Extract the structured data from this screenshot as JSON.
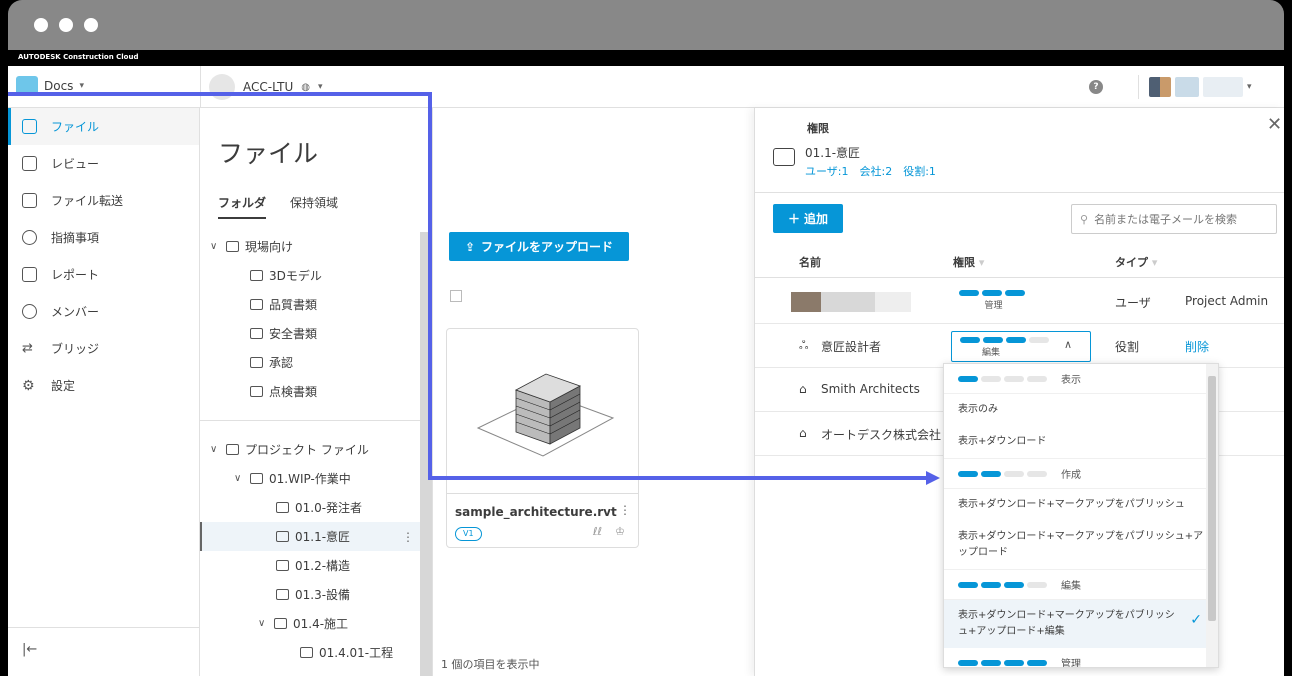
{
  "brand": "AUTODESK Construction Cloud",
  "topbar": {
    "module": "Docs",
    "project": "ACC-LTU",
    "help": "?"
  },
  "sidenav": {
    "items": [
      {
        "label": "ファイル",
        "icon": "file-icon",
        "active": true
      },
      {
        "label": "レビュー",
        "icon": "review-icon"
      },
      {
        "label": "ファイル転送",
        "icon": "transfer-icon"
      },
      {
        "label": "指摘事項",
        "icon": "issues-icon"
      },
      {
        "label": "レポート",
        "icon": "report-icon"
      },
      {
        "label": "メンバー",
        "icon": "members-icon"
      },
      {
        "label": "ブリッジ",
        "icon": "bridge-icon"
      },
      {
        "label": "設定",
        "icon": "settings-icon"
      }
    ],
    "collapse": "|←"
  },
  "files": {
    "title": "ファイル",
    "tabs": [
      "フォルダ",
      "保持領域"
    ],
    "tree_field": [
      "現場向け",
      "3Dモデル",
      "品質書類",
      "安全書類",
      "承認",
      "点検書類"
    ],
    "tree_project": [
      "プロジェクト ファイル",
      "01.WIP-作業中",
      "01.0-発注者",
      "01.1-意匠",
      "01.2-構造",
      "01.3-設備",
      "01.4-施工",
      "01.4.01-工程"
    ],
    "upload": "ファイルをアップロード",
    "card_name": "sample_architecture.rvt",
    "card_version": "V1",
    "count": "1 個の項目を表示中"
  },
  "permissions": {
    "title": "権限",
    "folder": "01.1-意匠",
    "counts": "ユーザ:1　会社:2　役割:1",
    "add": "追加",
    "search_placeholder": "名前または電子メールを検索",
    "col_name": "名前",
    "col_perm": "権限",
    "col_type": "タイプ",
    "row1": {
      "perm": "管理",
      "type": "ユーザ",
      "role": "Project Admin"
    },
    "row2": {
      "name": "意匠設計者",
      "perm": "編集",
      "type": "役割",
      "action": "削除"
    },
    "row3": {
      "name": "Smith Architects"
    },
    "row4": {
      "name": "オートデスク株式会社"
    }
  },
  "dropdown": {
    "g_view": "表示",
    "o_view_only": "表示のみ",
    "o_view_dl": "表示+ダウンロード",
    "g_create": "作成",
    "o_create1": "表示+ダウンロード+マークアップをパブリッシュ",
    "o_create2": "表示+ダウンロード+マークアップをパブリッシュ+アップロード",
    "g_edit": "編集",
    "o_edit": "表示+ダウンロード+マークアップをパブリッシュ+アップロード+編集",
    "g_manage": "管理"
  },
  "colors": {
    "accent": "#0696d7",
    "arrow": "#5561e8"
  }
}
